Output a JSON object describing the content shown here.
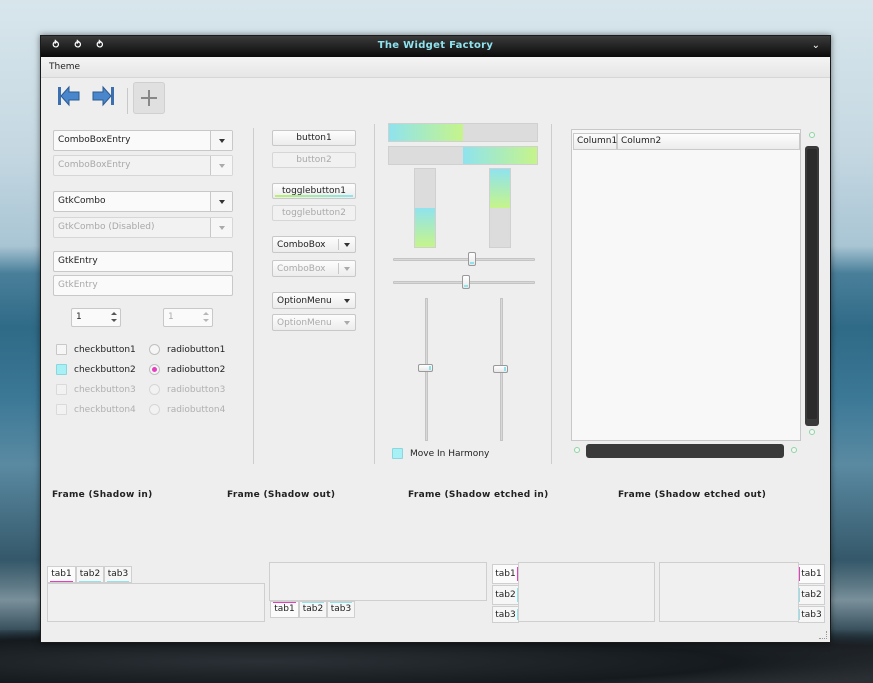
{
  "window": {
    "title": "The Widget Factory",
    "menu": [
      "Theme"
    ]
  },
  "colors": {
    "title_text": "#8fe3ee",
    "accent": "#8fe3ee",
    "gradient_green": "#b8f070",
    "radio_on": "#e53fbf"
  },
  "toolbar": {
    "icons": [
      "go-first-icon",
      "go-last-icon",
      "add-icon"
    ]
  },
  "left": {
    "comboboxentry": "ComboBoxEntry",
    "comboboxentry_disabled": "ComboBoxEntry",
    "gtkcombo": "GtkCombo",
    "gtkcombo_disabled": "GtkCombo (Disabled)",
    "entry": "GtkEntry",
    "entry_disabled": "GtkEntry",
    "spin1": "1",
    "spin2": "1",
    "checks": [
      {
        "label": "checkbutton1",
        "checked": false,
        "disabled": false
      },
      {
        "label": "checkbutton2",
        "checked": true,
        "disabled": false
      },
      {
        "label": "checkbutton3",
        "checked": false,
        "disabled": true
      },
      {
        "label": "checkbutton4",
        "checked": false,
        "disabled": true
      }
    ],
    "radios": [
      {
        "label": "radiobutton1",
        "checked": false,
        "disabled": false
      },
      {
        "label": "radiobutton2",
        "checked": true,
        "disabled": false
      },
      {
        "label": "radiobutton3",
        "checked": false,
        "disabled": true
      },
      {
        "label": "radiobutton4",
        "checked": false,
        "disabled": true
      }
    ]
  },
  "middle": {
    "button1": "button1",
    "button2": "button2",
    "toggle1": "togglebutton1",
    "toggle2": "togglebutton2",
    "combobox": "ComboBox",
    "combobox_disabled": "ComboBox",
    "optionmenu": "OptionMenu",
    "optionmenu_disabled": "OptionMenu"
  },
  "ranges": {
    "hprogress1": 0.5,
    "hprogress2": 0.5,
    "vprogress1": 0.5,
    "vprogress2": 0.5,
    "hscale1": 0.5,
    "hscale2": 0.5,
    "vscale1": 0.5,
    "vscale2": 0.5,
    "harmony_label": "Move In Harmony"
  },
  "tree": {
    "columns": [
      "Column1",
      "Column2"
    ]
  },
  "frames": [
    "Frame (Shadow in)",
    "Frame (Shadow out)",
    "Frame (Shadow etched in)",
    "Frame (Shadow etched out)"
  ],
  "notebooks": {
    "tabs": [
      "tab1",
      "tab2",
      "tab3"
    ]
  }
}
